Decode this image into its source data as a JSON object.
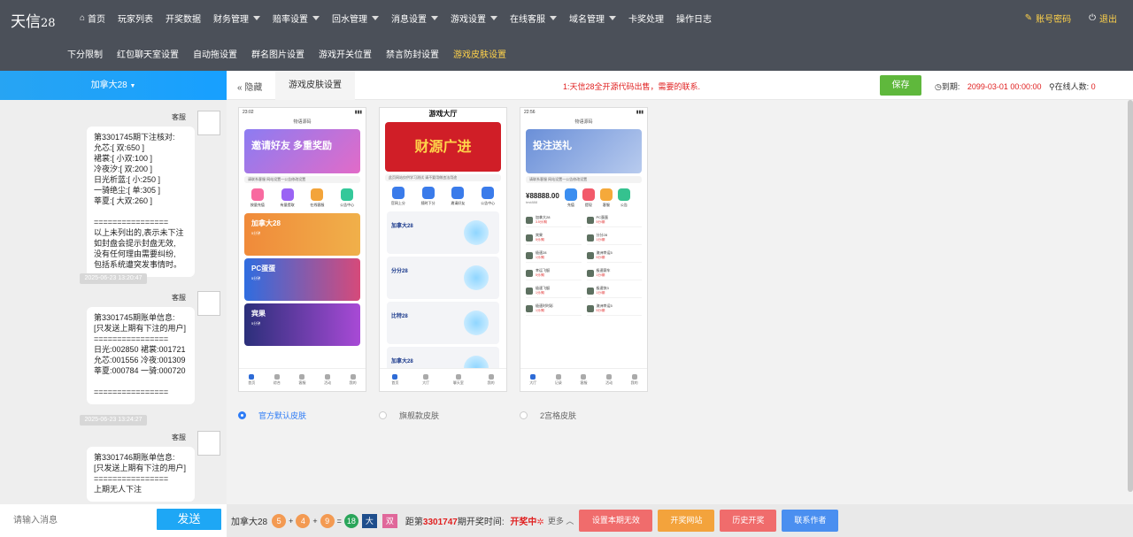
{
  "app": {
    "logo": "天信",
    "logo_num": "28"
  },
  "nav_main": [
    "首页",
    "玩家列表",
    "开奖数据",
    "财务管理",
    "赔率设置",
    "回水管理",
    "消息设置",
    "游戏设置",
    "在线客服",
    "域名管理",
    "卡奖处理",
    "操作日志"
  ],
  "nav_sub": [
    "下分限制",
    "红包聊天室设置",
    "自动拖设置",
    "群名图片设置",
    "游戏开关位置",
    "禁言防封设置",
    "游戏皮肤设置"
  ],
  "account": {
    "pwd": "账号密码",
    "logout": "退出"
  },
  "left": {
    "header": "加拿大28",
    "sender": "客服",
    "messages": [
      {
        "text": "第3301745期下注核对:\n允芯:[ 双:650 ]\n裙裳:[ 小双:100 ]\n冷夜汐:[ 双:200 ]\n日光析蓝:[ 小:250 ]\n一骑绝尘:[ 单:305 ]\n莘夏:[ 大双:260 ]\n\n================\n以上未列出的,表示未下注\n如封盘会提示封盘无效,\n没有任何理由需要纠纷,\n包括系统遭突发事情时。"
      },
      {
        "ts": "2025-06-23 13:20:47"
      },
      {
        "text": "第3301745期账单信息:\n[只发送上期有下注的用户]\n================\n日光:002850 裙裳:001721\n允芯:001556 冷夜:001309\n莘夏:000784 一骑:000720\n\n================"
      },
      {
        "ts": "2025-06-23 13:24:27"
      },
      {
        "text": "第3301746期账单信息:\n[只发送上期有下注的用户]\n================\n上期无人下注"
      }
    ],
    "input_placeholder": "请输入消息",
    "send": "发送"
  },
  "toolbar": {
    "hide": "隐藏",
    "tab": "游戏皮肤设置",
    "notice": "1:天信28全开源代码出售，需要的联系.",
    "save": "保存",
    "expire_label": "到期:",
    "expire_value": "2099-03-01 00:00:00",
    "online_label": "在线人数:",
    "online_value": "0"
  },
  "skins": [
    {
      "label": "官方默认皮肤",
      "selected": true
    },
    {
      "label": "旗舰款皮肤",
      "selected": false
    },
    {
      "label": "2宫格皮肤",
      "selected": false
    }
  ],
  "phones": {
    "p1": {
      "time": "23:02",
      "title": "物语源码",
      "banner": "邀请好友 多重奖励",
      "notice": "请联系客服 网站设置一公告修改设置",
      "quick": [
        "按量充值",
        "有量提取",
        "在线客服",
        "公告中心"
      ],
      "cards": [
        {
          "name": "加拿大28",
          "sub": "5分钟"
        },
        {
          "name": "PC蛋蛋",
          "sub": "5分钟"
        },
        {
          "name": "宾果",
          "sub": "5分钟"
        }
      ],
      "tabs": [
        "首页",
        "综合",
        "客服",
        "活动",
        "我的"
      ]
    },
    "p2": {
      "title": "游戏大厅",
      "banner": "财源广进",
      "notice": "此页网站仅供学习测试 请不要用做违法用途",
      "quick": [
        "官网上分",
        "随时下分",
        "邀请好友",
        "公告中心"
      ],
      "lots": [
        {
          "name": "加拿大28"
        },
        {
          "name": "分分28"
        },
        {
          "name": "比特28"
        },
        {
          "name": "加拿大28"
        }
      ],
      "tabs": [
        "首页",
        "大厅",
        "聊天室",
        "我的"
      ]
    },
    "p3": {
      "time": "22:56",
      "title": "物语源码",
      "banner": "投注送礼",
      "notice": "请联系客服 网站设置一公告修改设置",
      "balance": "¥88888.00",
      "user": "test888",
      "quick": [
        "充值",
        "提现",
        "客服",
        "公告"
      ],
      "games": [
        {
          "name": "加拿大28",
          "sub": "3.5分/期"
        },
        {
          "name": "PC蛋蛋",
          "sub": "5分/期"
        },
        {
          "name": "宾果",
          "sub": "5分/期"
        },
        {
          "name": "分分28",
          "sub": "1分/期"
        },
        {
          "name": "极速28",
          "sub": "1分/期"
        },
        {
          "name": "澳洲幸运5",
          "sub": "5分/期"
        },
        {
          "name": "幸运飞艇",
          "sub": "5分/期"
        },
        {
          "name": "极速赛车",
          "sub": "1分/期"
        },
        {
          "name": "极速飞艇",
          "sub": "1分/期"
        },
        {
          "name": "极速快3",
          "sub": "1分/期"
        },
        {
          "name": "极速时时彩",
          "sub": "1分/期"
        },
        {
          "name": "澳洲幸运5",
          "sub": "5分/期"
        }
      ],
      "tabs": [
        "大厅",
        "记录",
        "客服",
        "活动",
        "我的"
      ]
    }
  },
  "bottom": {
    "game": "加拿大28",
    "n1": "5",
    "n2": "4",
    "n3": "9",
    "sum": "18",
    "big": "大",
    "even": "双",
    "draw_prefix": "距第",
    "draw_period": "3301747",
    "draw_suffix": "期开奖时间:",
    "draw_status": "开奖中",
    "more": "更多",
    "btn_invalid": "设置本期无效",
    "btn_site": "开奖网站",
    "btn_history": "历史开奖",
    "btn_contact": "联系作者"
  }
}
